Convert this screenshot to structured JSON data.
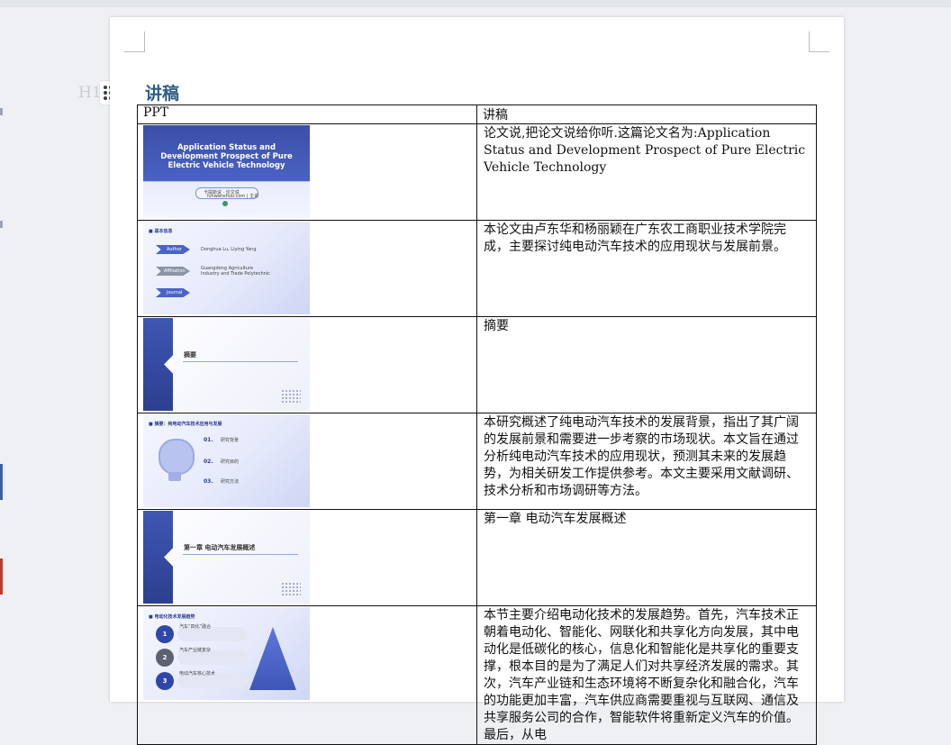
{
  "heading": "讲稿",
  "gutter_hint": "H1",
  "table": {
    "headers": [
      "PPT",
      "讲稿"
    ],
    "rows": [
      {
        "text": "论文说,把论文说给你听.这篇论文名为:Application Status and Development Prospect of Pure Electric Vehicle Technology"
      },
      {
        "text": "本论文由卢东华和杨丽颖在广东农工商职业技术学院完成，主要探讨纯电动汽车技术的应用现状与发展前景。"
      },
      {
        "text": "摘要"
      },
      {
        "text": "本研究概述了纯电动汽车技术的发展背景，指出了其广阔的发展前景和需要进一步考察的市场现状。本文旨在通过分析纯电动汽车技术的应用现状，预测其未来的发展趋势，为相关研发工作提供参考。本文主要采用文献调研、技术分析和市场调研等方法。"
      },
      {
        "text": "第一章 电动汽车发展概述"
      },
      {
        "text": "本节主要介绍电动化技术的发展趋势。首先，汽车技术正朝着电动化、智能化、网联化和共享化方向发展，其中电动化是低碳化的核心，信息化和智能化是共享化的重要支撑，根本目的是为了满足人们对共享经济发展的需求。其次，汽车产业链和生态环境将不断复杂化和融合化，汽车的功能更加丰富，汽车供应商需要重视与互联网、通信及共享服务公司的合作，智能软件将重新定义汽车的价值。最后，从电"
      }
    ]
  },
  "slides": {
    "cover": {
      "title": "Application Status and Development Prospect of Pure Electric Vehicle Technology",
      "sub1": "卡提斯说 · 论文说",
      "sub2": "lunwenshuo.com | 主讲"
    },
    "basic": {
      "title": "■ 基本信息",
      "labels": [
        "Author",
        "Affiliation",
        "Journal"
      ],
      "vals": [
        "Donghua Lu, Liying Yang",
        "Guangdong Agriculture Industry and Trade Polytechnic"
      ]
    },
    "abstract": {
      "title": "摘要"
    },
    "abstract_toc": {
      "title": "■ 摘要：纯电动汽车技术应用与发展",
      "nums": [
        "01.",
        "02.",
        "03."
      ],
      "items": [
        "研究背景",
        "研究目的",
        "研究方法"
      ]
    },
    "chapter1": {
      "title": "第一章 电动汽车发展概述"
    },
    "trend": {
      "title": "■ 电动化技术发展趋势",
      "nums": [
        "1",
        "2",
        "3"
      ],
      "items": [
        "汽车“四化”融合",
        "汽车产业链复杂",
        "电动汽车核心技术"
      ]
    }
  }
}
